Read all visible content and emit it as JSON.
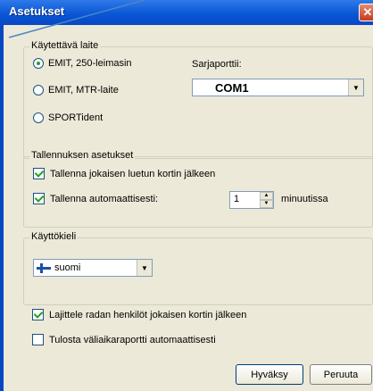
{
  "window": {
    "title": "Asetukset",
    "close_label": "✕"
  },
  "device_group": {
    "legend": "Käytettävä laite",
    "options": [
      "EMIT, 250-leimasin",
      "EMIT, MTR-laite",
      "SPORTident"
    ],
    "selected_index": 0,
    "serial_port_label": "Sarjaporttii:",
    "serial_port_value": "COM1"
  },
  "save_group": {
    "legend": "Tallennuksen asetukset",
    "save_after_each_label": "Tallenna jokaisen luetun kortin jälkeen",
    "save_after_each_checked": true,
    "autosave_label": "Tallenna automaattisesti:",
    "autosave_checked": true,
    "autosave_value": "1",
    "autosave_unit": "minuutissa"
  },
  "language_group": {
    "legend": "Käyttökieli",
    "selected": "suomi"
  },
  "options": {
    "sort_label": "Lajittele radan henkilöt jokaisen kortin jälkeen",
    "sort_checked": true,
    "print_label": "Tulosta väliaikaraportti automaattisesti",
    "print_checked": false
  },
  "buttons": {
    "ok": "Hyväksy",
    "cancel": "Peruuta"
  },
  "colors": {
    "titlebar": "#0a57d6",
    "dialog_bg": "#ece9d8",
    "window_border": "#0747c5"
  }
}
